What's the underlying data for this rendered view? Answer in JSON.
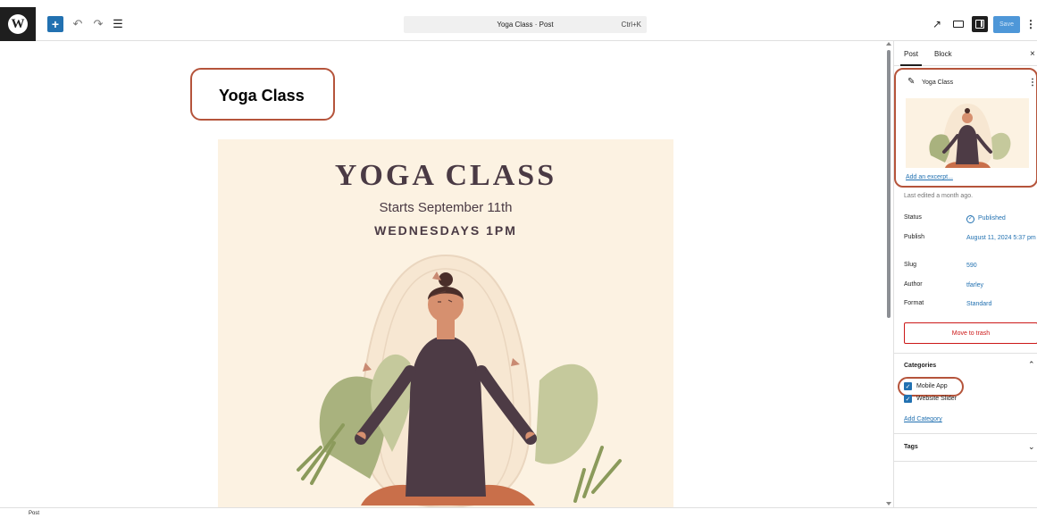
{
  "toolbar": {
    "logo": "W",
    "add_icon": "+",
    "undo_icon": "↶",
    "redo_icon": "↷",
    "listview_icon": "☰",
    "command_title": "Yoga Class · Post",
    "command_shortcut": "Ctrl+K",
    "external_icon": "↗",
    "save_label": "Save",
    "more_icon": "⋮"
  },
  "editor": {
    "post_title": "Yoga Class",
    "poster": {
      "heading": "YOGA CLASS",
      "subheading": "Starts September 11th",
      "schedule": "WEDNESDAYS 1PM"
    }
  },
  "sidebar": {
    "tabs": [
      "Post",
      "Block"
    ],
    "close_icon": "×",
    "post_card": {
      "title": "Yoga Class",
      "excerpt_link": "Add an excerpt..."
    },
    "last_edited": "Last edited a month ago.",
    "meta": {
      "status_label": "Status",
      "status_value": "Published",
      "publish_label": "Publish",
      "publish_value": "August 11, 2024 5:37 pm",
      "slug_label": "Slug",
      "slug_value": "590",
      "author_label": "Author",
      "author_value": "tfarley",
      "format_label": "Format",
      "format_value": "Standard"
    },
    "trash_label": "Move to trash",
    "categories": {
      "title": "Categories",
      "items": [
        "Mobile App",
        "Website Slider"
      ],
      "add_link": "Add Category"
    },
    "tags_title": "Tags"
  },
  "statusbar": {
    "breadcrumb": "Post"
  },
  "colors": {
    "accent": "#2271b1",
    "highlight": "#b5543b",
    "poster_bg": "#fcf2e2",
    "danger": "#cc1818"
  }
}
